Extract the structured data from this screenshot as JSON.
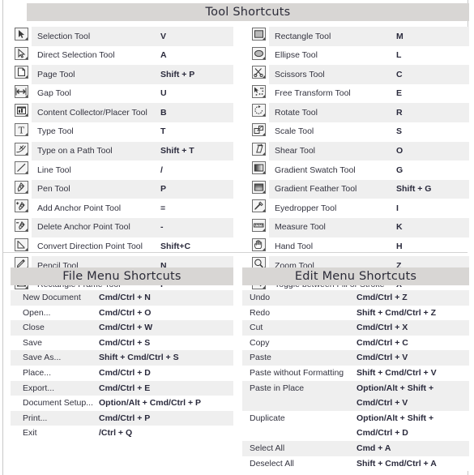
{
  "sections": {
    "tools": {
      "title": "Tool Shortcuts",
      "left_column": [
        {
          "icon": "selection-tool-icon",
          "label": "Selection Tool",
          "key": "V"
        },
        {
          "icon": "direct-selection-tool-icon",
          "label": "Direct Selection Tool",
          "key": "A"
        },
        {
          "icon": "page-tool-icon",
          "label": "Page Tool",
          "key": "Shift + P"
        },
        {
          "icon": "gap-tool-icon",
          "label": "Gap Tool",
          "key": "U"
        },
        {
          "icon": "content-collector-tool-icon",
          "label": "Content Collector/Placer Tool",
          "key": "B"
        },
        {
          "icon": "type-tool-icon",
          "label": "Type Tool",
          "key": "T"
        },
        {
          "icon": "type-on-a-path-tool-icon",
          "label": "Type on a Path Tool",
          "key": "Shift + T"
        },
        {
          "icon": "line-tool-icon",
          "label": "Line Tool",
          "key": "/"
        },
        {
          "icon": "pen-tool-icon",
          "label": "Pen Tool",
          "key": "P"
        },
        {
          "icon": "add-anchor-point-tool-icon",
          "label": "Add Anchor Point Tool",
          "key": "="
        },
        {
          "icon": "delete-anchor-point-tool-icon",
          "label": "Delete Anchor Point Tool",
          "key": "-"
        },
        {
          "icon": "convert-direction-point-tool-icon",
          "label": "Convert Direction Point Tool",
          "key": "Shift+C"
        },
        {
          "icon": "pencil-tool-icon",
          "label": "Pencil Tool",
          "key": "N"
        },
        {
          "icon": "rectangle-frame-tool-icon",
          "label": "Rectangle Frame Tool",
          "key": "F"
        }
      ],
      "right_column": [
        {
          "icon": "rectangle-tool-icon",
          "label": "Rectangle Tool",
          "key": "M"
        },
        {
          "icon": "ellipse-tool-icon",
          "label": "Ellipse Tool",
          "key": "L"
        },
        {
          "icon": "scissors-tool-icon",
          "label": "Scissors Tool",
          "key": "C"
        },
        {
          "icon": "free-transform-tool-icon",
          "label": "Free Transform Tool",
          "key": "E"
        },
        {
          "icon": "rotate-tool-icon",
          "label": "Rotate Tool",
          "key": "R"
        },
        {
          "icon": "scale-tool-icon",
          "label": "Scale Tool",
          "key": "S"
        },
        {
          "icon": "shear-tool-icon",
          "label": "Shear Tool",
          "key": "O"
        },
        {
          "icon": "gradient-swatch-tool-icon",
          "label": "Gradient Swatch Tool",
          "key": "G"
        },
        {
          "icon": "gradient-feather-tool-icon",
          "label": "Gradient Feather Tool",
          "key": "Shift + G"
        },
        {
          "icon": "eyedropper-tool-icon",
          "label": "Eyedropper Tool",
          "key": "I"
        },
        {
          "icon": "measure-tool-icon",
          "label": "Measure Tool",
          "key": "K"
        },
        {
          "icon": "hand-tool-icon",
          "label": "Hand Tool",
          "key": "H"
        },
        {
          "icon": "zoom-tool-icon",
          "label": "Zoom Tool",
          "key": "Z"
        },
        {
          "icon": "toggle-fill-stroke-icon",
          "label": "Toggle between Fill or Stroke",
          "key": "X"
        }
      ]
    },
    "file_menu": {
      "title": "File Menu Shortcuts",
      "rows": [
        {
          "label": "New Document",
          "key": "Cmd/Ctrl + N"
        },
        {
          "label": "Open...",
          "key": "Cmd/Ctrl + O"
        },
        {
          "label": "Close",
          "key": "Cmd/Ctrl + W"
        },
        {
          "label": "Save",
          "key": "Cmd/Ctrl + S"
        },
        {
          "label": "Save As...",
          "key": "Shift + Cmd/Ctrl + S"
        },
        {
          "label": "Place...",
          "key": "Cmd/Ctrl + D"
        },
        {
          "label": "Export...",
          "key": "Cmd/Ctrl + E"
        },
        {
          "label": "Document Setup...",
          "key": "Option/Alt + Cmd/Ctrl + P"
        },
        {
          "label": "Print...",
          "key": "Cmd/Ctrl + P"
        },
        {
          "label": "Exit",
          "key": "/Ctrl + Q"
        }
      ]
    },
    "edit_menu": {
      "title": "Edit Menu Shortcuts",
      "rows": [
        {
          "label": "Undo",
          "key": "Cmd/Ctrl + Z"
        },
        {
          "label": "Redo",
          "key": "Shift + Cmd/Ctrl + Z"
        },
        {
          "label": "Cut",
          "key": "Cmd/Ctrl + X"
        },
        {
          "label": "Copy",
          "key": "Cmd/Ctrl + C"
        },
        {
          "label": "Paste",
          "key": "Cmd/Ctrl + V"
        },
        {
          "label": "Paste without Formatting",
          "key": "Shift + Cmd/Ctrl + V"
        },
        {
          "label": "Paste in Place",
          "key": "Option/Alt + Shift +",
          "key2": "Cmd/Ctrl + V"
        },
        {
          "label": "Duplicate",
          "key": "Option/Alt + Shift +",
          "key2": "Cmd/Ctrl + D"
        },
        {
          "label": "Select All",
          "key": "Cmd + A"
        },
        {
          "label": "Deselect All",
          "key": "Shift + Cmd/Ctrl + A"
        }
      ]
    }
  },
  "colors": {
    "band_background": "#d8d6d4",
    "row_stripe": "#efefef",
    "text": "#33333f",
    "border": "#c9c9c9"
  }
}
